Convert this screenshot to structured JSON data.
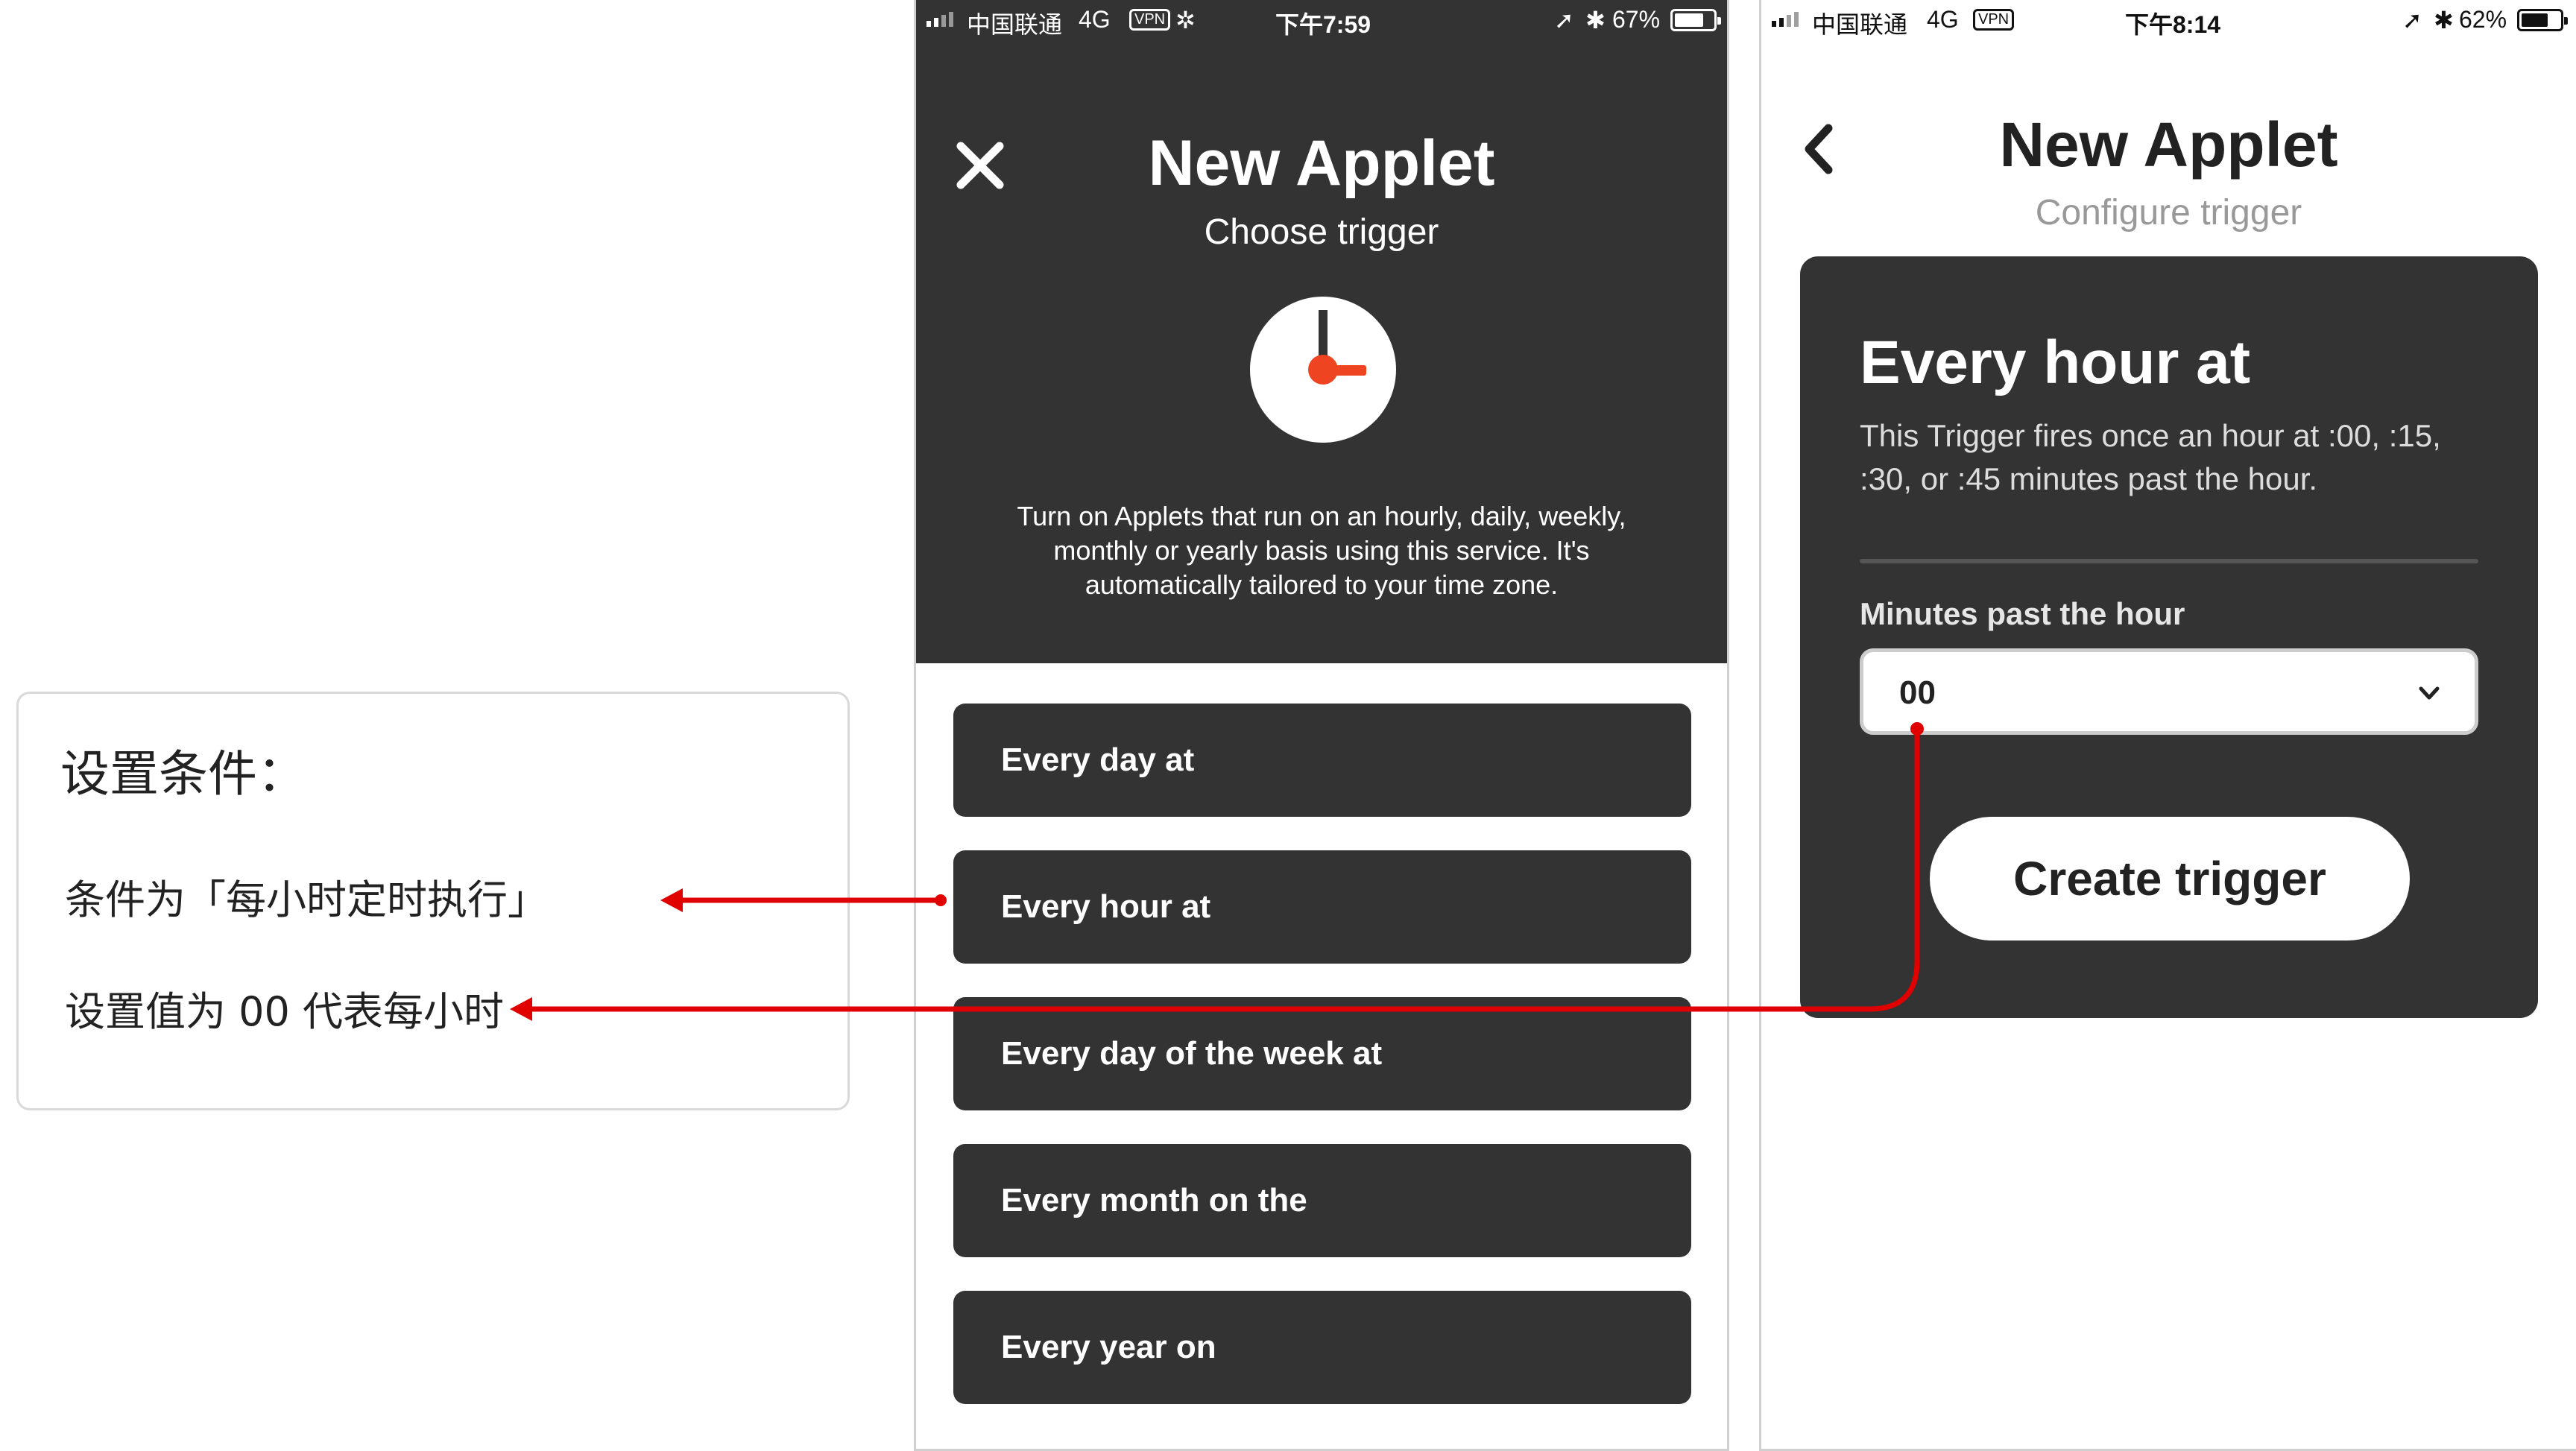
{
  "annotation": {
    "title": "设置条件：",
    "line1": "条件为「每小时定时执行」",
    "line2": "设置值为 00 代表每小时"
  },
  "phone1": {
    "status": {
      "carrier": "中国联通",
      "network": "4G",
      "vpn": "VPN",
      "time": "下午7:59",
      "battery": "67%",
      "battery_level": 0.67
    },
    "title": "New Applet",
    "subtitle": "Choose trigger",
    "description": "Turn on Applets that run on an hourly, daily, weekly, monthly or yearly basis using this service. It's automatically tailored to your time zone.",
    "triggers": [
      "Every day at",
      "Every hour at",
      "Every day of the week at",
      "Every month on the",
      "Every year on"
    ]
  },
  "phone2": {
    "status": {
      "carrier": "中国联通",
      "network": "4G",
      "vpn": "VPN",
      "time": "下午8:14",
      "battery": "62%",
      "battery_level": 0.62
    },
    "title": "New Applet",
    "subtitle": "Configure trigger",
    "card": {
      "title": "Every hour at",
      "description": "This Trigger fires once an hour at :00, :15, :30, or :45 minutes past the hour.",
      "field_label": "Minutes past the hour",
      "field_value": "00",
      "button": "Create trigger"
    }
  },
  "colors": {
    "dark": "#333333",
    "accent": "#ee4422",
    "arrow": "#e00000"
  }
}
